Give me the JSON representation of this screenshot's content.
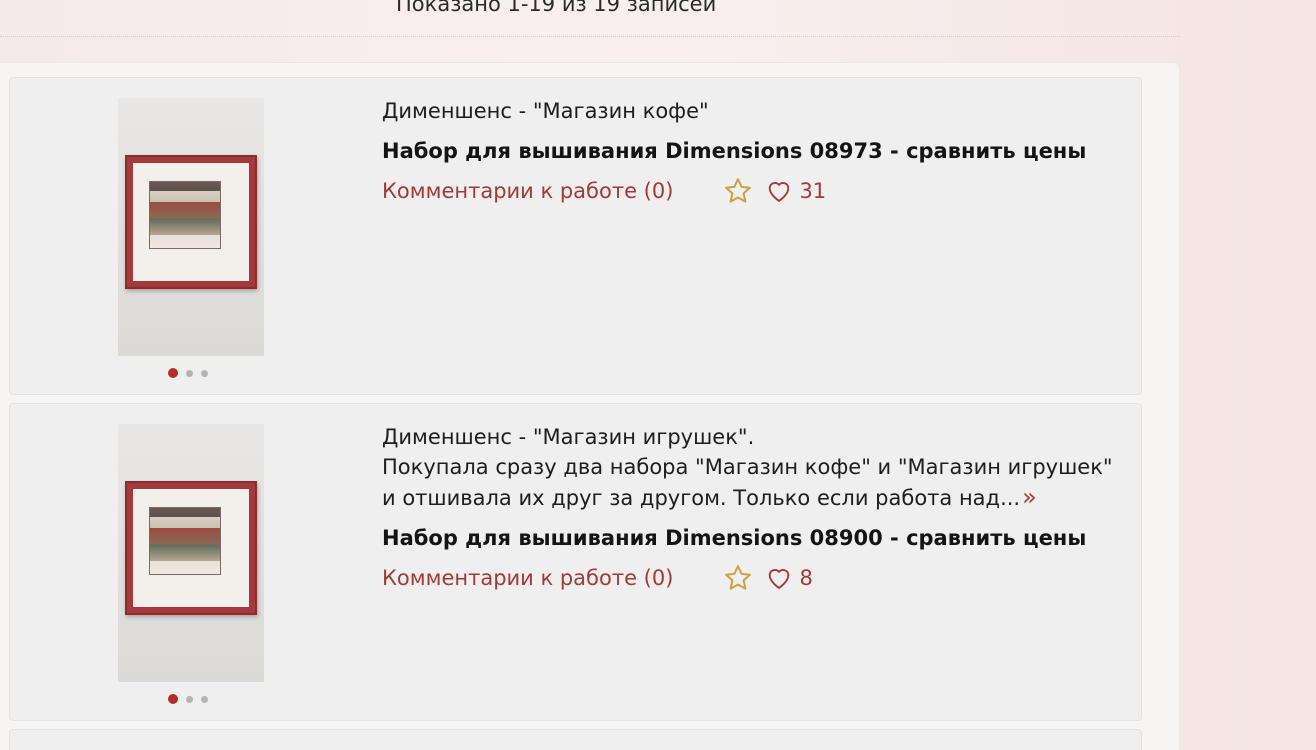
{
  "summary": "Показано 1-19 из 19 записей",
  "colors": {
    "accent": "#a33a3a",
    "star": "#c9a23d",
    "dot_active": "#b42c2c"
  },
  "works": [
    {
      "title": "Дименшенс - \"Магазин кофе\"",
      "description": "",
      "product": "Набор для вышивания Dimensions 08973 - сравнить цены",
      "comments": "Комментарии к работе (0)",
      "likes": "31"
    },
    {
      "title": "Дименшенс - \"Магазин игрушек\".",
      "description": "Покупала сразу два набора \"Магазин кофе\" и \"Магазин игрушек\" и отшивала их друг за другом. Только если работа над...",
      "more_icon": "double-chevron-right-icon",
      "product": "Набор для вышивания Dimensions 08900 - сравнить цены",
      "comments": "Комментарии к работе (0)",
      "likes": "8"
    }
  ]
}
